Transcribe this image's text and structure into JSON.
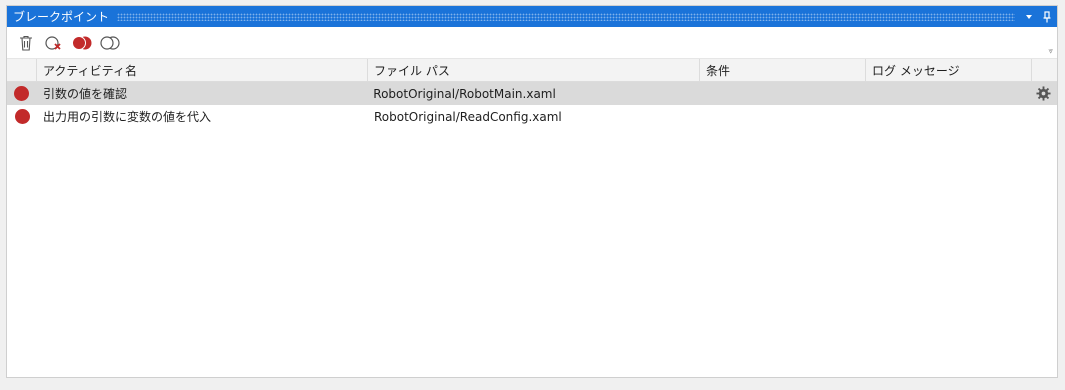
{
  "panel": {
    "title": "ブレークポイント",
    "title_icons": [
      "chevron-down-icon",
      "pin-icon"
    ]
  },
  "toolbar": {
    "buttons": [
      "trash-icon",
      "remove-breakpoint-icon",
      "toggle-breakpoints-icon",
      "disable-breakpoints-icon"
    ]
  },
  "table": {
    "columns": [
      "",
      "アクティビティ名",
      "ファイル パス",
      "条件",
      "ログ メッセージ",
      ""
    ],
    "rows": [
      {
        "activity": "引数の値を確認",
        "path": "RobotOriginal/RobotMain.xaml",
        "condition": "",
        "log": "",
        "selected": true
      },
      {
        "activity": "出力用の引数に変数の値を代入",
        "path": "RobotOriginal/ReadConfig.xaml",
        "condition": "",
        "log": "",
        "selected": false
      }
    ]
  },
  "colors": {
    "titlebar": "#1a73d9",
    "breakpoint": "#c22a2a",
    "selected_row": "#dadada"
  }
}
